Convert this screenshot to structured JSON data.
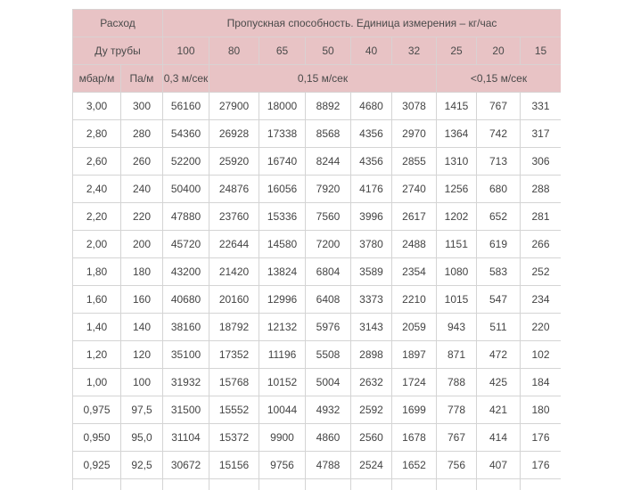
{
  "header": {
    "rashod": "Расход",
    "capacity_title": "Пропускная способность. Единица измерения – кг/час",
    "du_label": "Ду трубы",
    "diameters": [
      "100",
      "80",
      "65",
      "50",
      "40",
      "32",
      "25",
      "20",
      "15"
    ],
    "unit_mbar": "мбар/м",
    "unit_pa": "Па/м",
    "speed_1": "0,3 м/сек",
    "speed_2": "0,15 м/сек",
    "speed_3": "<0,15 м/сек"
  },
  "rows": [
    [
      "3,00",
      "300",
      "56160",
      "27900",
      "18000",
      "8892",
      "4680",
      "3078",
      "1415",
      "767",
      "331"
    ],
    [
      "2,80",
      "280",
      "54360",
      "26928",
      "17338",
      "8568",
      "4356",
      "2970",
      "1364",
      "742",
      "317"
    ],
    [
      "2,60",
      "260",
      "52200",
      "25920",
      "16740",
      "8244",
      "4356",
      "2855",
      "1310",
      "713",
      "306"
    ],
    [
      "2,40",
      "240",
      "50400",
      "24876",
      "16056",
      "7920",
      "4176",
      "2740",
      "1256",
      "680",
      "288"
    ],
    [
      "2,20",
      "220",
      "47880",
      "23760",
      "15336",
      "7560",
      "3996",
      "2617",
      "1202",
      "652",
      "281"
    ],
    [
      "2,00",
      "200",
      "45720",
      "22644",
      "14580",
      "7200",
      "3780",
      "2488",
      "1151",
      "619",
      "266"
    ],
    [
      "1,80",
      "180",
      "43200",
      "21420",
      "13824",
      "6804",
      "3589",
      "2354",
      "1080",
      "583",
      "252"
    ],
    [
      "1,60",
      "160",
      "40680",
      "20160",
      "12996",
      "6408",
      "3373",
      "2210",
      "1015",
      "547",
      "234"
    ],
    [
      "1,40",
      "140",
      "38160",
      "18792",
      "12132",
      "5976",
      "3143",
      "2059",
      "943",
      "511",
      "220"
    ],
    [
      "1,20",
      "120",
      "35100",
      "17352",
      "11196",
      "5508",
      "2898",
      "1897",
      "871",
      "472",
      "102"
    ],
    [
      "1,00",
      "100",
      "31932",
      "15768",
      "10152",
      "5004",
      "2632",
      "1724",
      "788",
      "425",
      "184"
    ],
    [
      "0,975",
      "97,5",
      "31500",
      "15552",
      "10044",
      "4932",
      "2592",
      "1699",
      "778",
      "421",
      "180"
    ],
    [
      "0,950",
      "95,0",
      "31104",
      "15372",
      "9900",
      "4860",
      "2560",
      "1678",
      "767",
      "414",
      "176"
    ],
    [
      "0,925",
      "92,5",
      "30672",
      "15156",
      "9756",
      "4788",
      "2524",
      "1652",
      "756",
      "407",
      "176"
    ],
    [
      "",
      "",
      "",
      "",
      "",
      "",
      "",
      "",
      "",
      "",
      ""
    ]
  ]
}
